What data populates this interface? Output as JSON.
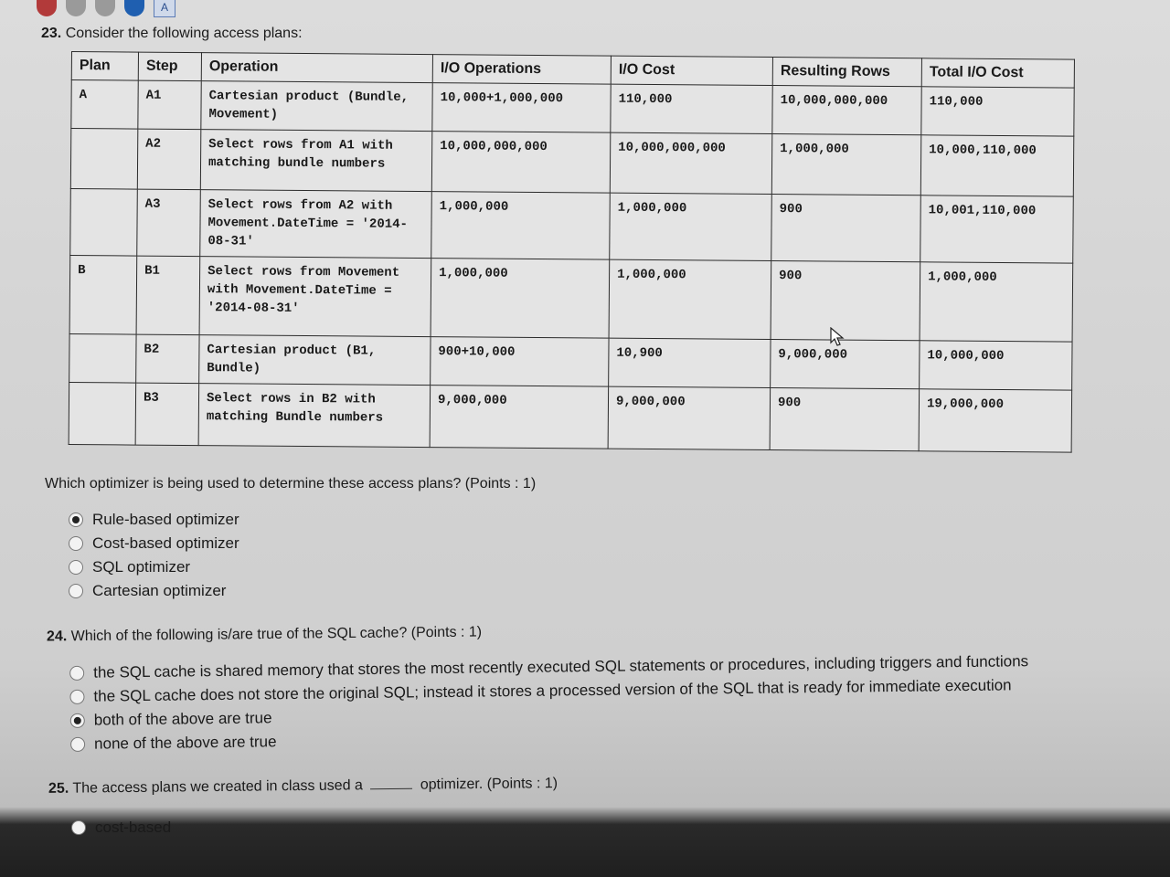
{
  "q23": {
    "number": "23.",
    "title": "Consider the following access plans:",
    "headers": [
      "Plan",
      "Step",
      "Operation",
      "I/O Operations",
      "I/O Cost",
      "Resulting Rows",
      "Total I/O Cost"
    ],
    "rows": [
      {
        "plan": "A",
        "step": "A1",
        "op": "Cartesian product (Bundle, Movement)",
        "io_ops": "10,000+1,000,000",
        "io_cost": "110,000",
        "rows": "10,000,000,000",
        "total": "110,000"
      },
      {
        "plan": "",
        "step": "A2",
        "op": "Select rows from A1 with matching bundle numbers",
        "io_ops": "10,000,000,000",
        "io_cost": "10,000,000,000",
        "rows": "1,000,000",
        "total": "10,000,110,000"
      },
      {
        "plan": "",
        "step": "A3",
        "op": "Select rows from A2 with Movement.DateTime = '2014-08-31'",
        "io_ops": "1,000,000",
        "io_cost": "1,000,000",
        "rows": "900",
        "total": "10,001,110,000"
      },
      {
        "plan": "B",
        "step": "B1",
        "op": "Select rows from Movement with Movement.DateTime = '2014-08-31'",
        "io_ops": "1,000,000",
        "io_cost": "1,000,000",
        "rows": "900",
        "total": "1,000,000"
      },
      {
        "plan": "",
        "step": "B2",
        "op": "Cartesian product (B1, Bundle)",
        "io_ops": "900+10,000",
        "io_cost": "10,900",
        "rows": "9,000,000",
        "total": "10,000,000"
      },
      {
        "plan": "",
        "step": "B3",
        "op": "Select rows in B2 with matching Bundle numbers",
        "io_ops": "9,000,000",
        "io_cost": "9,000,000",
        "rows": "900",
        "total": "19,000,000"
      }
    ],
    "question": "Which optimizer is being used to determine these access plans? (Points : 1)",
    "options": [
      "Rule-based optimizer",
      "Cost-based optimizer",
      "SQL optimizer",
      "Cartesian optimizer"
    ],
    "selected": 0
  },
  "q24": {
    "number": "24.",
    "question": "Which of the following is/are true of the SQL cache? (Points : 1)",
    "options": [
      "the SQL cache is shared memory that stores the most recently executed SQL statements or procedures, including triggers and functions",
      "the SQL cache does not store the original SQL; instead it stores a processed version of the SQL that is ready for immediate execution",
      "both of the above are true",
      "none of the above are true"
    ],
    "selected": 2
  },
  "q25": {
    "number": "25.",
    "question_pre": "The access plans we created in class used a",
    "question_post": "optimizer. (Points : 1)",
    "options": [
      "cost-based"
    ]
  }
}
